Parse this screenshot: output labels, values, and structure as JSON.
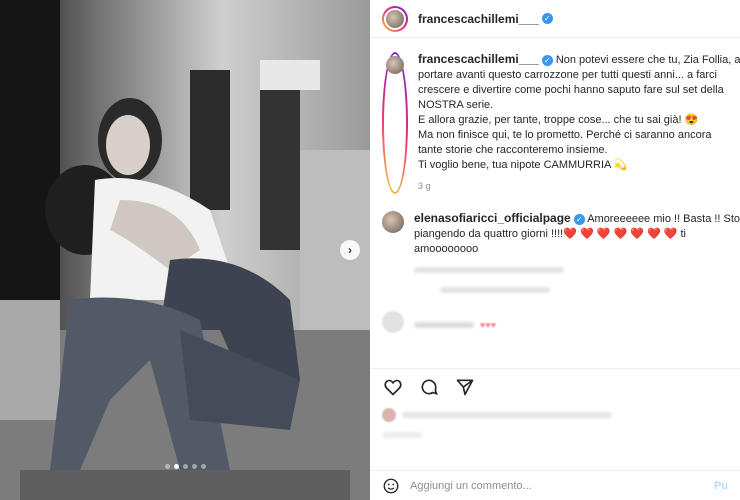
{
  "colors": {
    "accent": "#3897f0",
    "heart": "#ed1c24",
    "muted": "#8e8e8e"
  },
  "header": {
    "username": "francescachillemi___"
  },
  "media": {
    "carousel_dots": 5,
    "active_dot": 2,
    "next_icon": "chevron-right-icon"
  },
  "caption": {
    "username": "francescachillemi___",
    "lines": [
      "Non potevi essere che tu, Zia Follia, a",
      "portare avanti questo carrozzone per tutti questi anni... a farci",
      "crescere e divertire come pochi hanno saputo fare sul set della",
      "NOSTRA serie.",
      "E allora grazie, per tante, troppe cose... che tu sai già! 😍",
      "Ma non finisce qui, te lo prometto. Perché ci saranno ancora",
      "tante storie che racconteremo insieme.",
      "Ti voglio bene, tua nipote CAMMURRIA 💫"
    ],
    "time": "3 g"
  },
  "reply": {
    "username": "elenasofiaricci_officialpage",
    "lines": [
      "Amoreeeeee mio !! Basta !! Sto",
      "piangendo da quattro giorni !!!!❤️ ❤️ ❤️ ❤️ ❤️ ❤️ ❤️ ti",
      "amoooooooo"
    ]
  },
  "actions": {
    "like_icon": "heart-icon",
    "comment_icon": "comment-icon",
    "share_icon": "share-icon"
  },
  "add_comment": {
    "placeholder": "Aggiungi un commento...",
    "post_label": "Pu",
    "emoji_icon": "smiley-icon"
  }
}
